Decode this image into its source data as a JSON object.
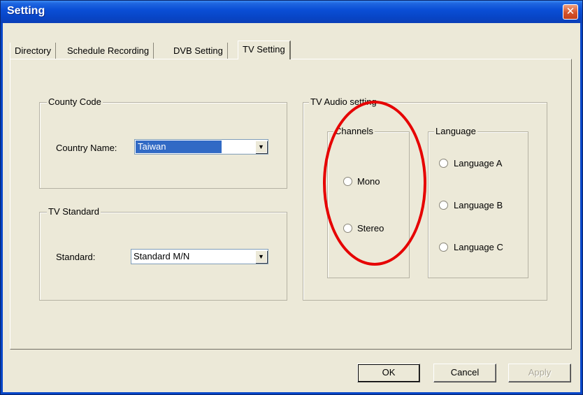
{
  "window": {
    "title": "Setting",
    "close_glyph": "✕"
  },
  "tabs": [
    {
      "label": "Directory"
    },
    {
      "label": "Schedule Recording"
    },
    {
      "label": "DVB Setting"
    },
    {
      "label": "TV Setting",
      "active": true
    }
  ],
  "country_code": {
    "legend": "County Code",
    "label": "Country Name:",
    "value": "Taiwan"
  },
  "tv_standard": {
    "legend": "TV Standard",
    "label": "Standard:",
    "value": "Standard M/N"
  },
  "audio": {
    "legend": "TV Audio setting",
    "channels": {
      "legend": "Channels",
      "options": [
        "Mono",
        "Stereo"
      ]
    },
    "language": {
      "legend": "Language",
      "options": [
        "Language A",
        "Language B",
        "Language C"
      ]
    }
  },
  "buttons": {
    "ok": "OK",
    "cancel": "Cancel",
    "apply": "Apply"
  },
  "icons": {
    "close": "close-icon",
    "dropdown": "chevron-down-icon"
  },
  "colors": {
    "title_bar": "#0a4fd6",
    "highlight": "#e60000",
    "dialog_bg": "#ece9d8"
  }
}
